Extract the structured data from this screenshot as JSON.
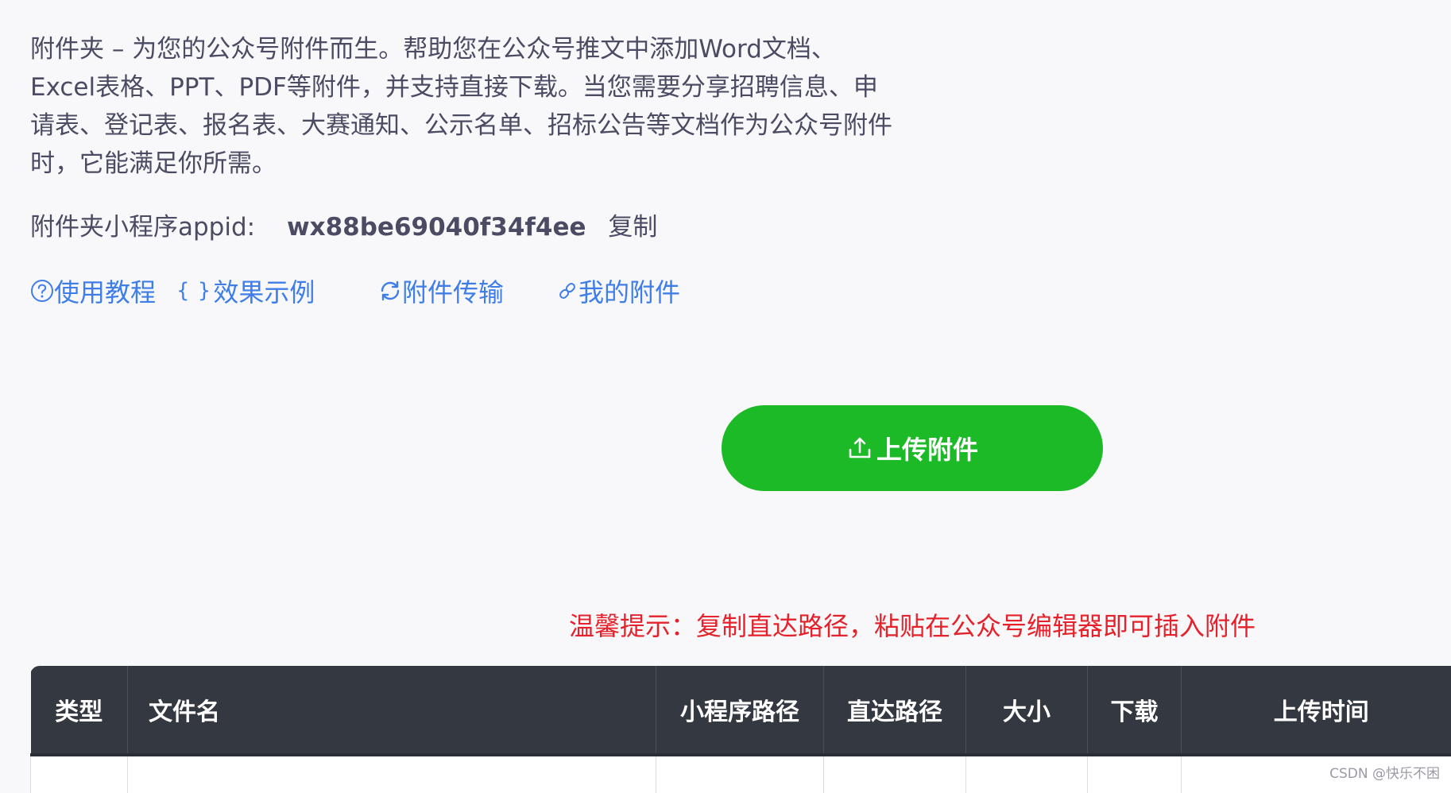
{
  "description": "附件夹 – 为您的公众号附件而生。帮助您在公众号推文中添加Word文档、Excel表格、PPT、PDF等附件，并支持直接下载。当您需要分享招聘信息、申请表、登记表、报名表、大赛通知、公示名单、招标公告等文档作为公众号附件时，它能满足你所需。",
  "appid": {
    "label": "附件夹小程序appid:",
    "value": "wx88be69040f34f4ee",
    "copy_label": "复制"
  },
  "links": {
    "tutorial": "使用教程",
    "example": "效果示例",
    "example_icon": "{ }",
    "transfer": "附件传输",
    "my_attachments": "我的附件"
  },
  "upload_button": "上传附件",
  "tip": "温馨提示：复制直达路径，粘贴在公众号编辑器即可插入附件",
  "table": {
    "columns": [
      "类型",
      "文件名",
      "小程序路径",
      "直达路径",
      "大小",
      "下载",
      "上传时间"
    ]
  },
  "watermark": "CSDN @快乐不困",
  "colors": {
    "link": "#3f7ee8",
    "upload_button": "#1dba28",
    "tip": "#e5222b",
    "table_header": "#343841"
  },
  "icons": {
    "tutorial": "question-circle-icon",
    "example": "braces-icon",
    "transfer": "refresh-icon",
    "my_attachments": "link-icon",
    "upload": "upload-icon"
  }
}
